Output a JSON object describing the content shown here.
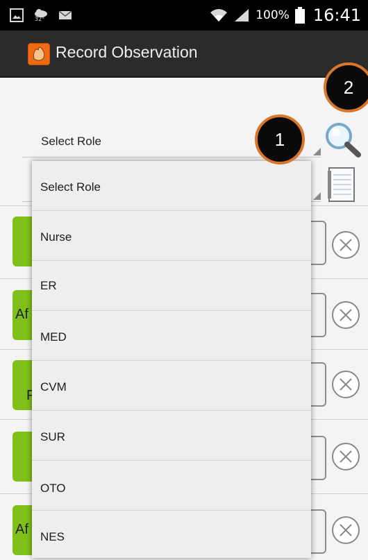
{
  "statusbar": {
    "left_icons": [
      "image-icon",
      "weather-icon",
      "mail-icon"
    ],
    "temp": "32°",
    "battery_pct": "100%",
    "time": "16:41"
  },
  "actionbar": {
    "title": "Record Observation"
  },
  "form": {
    "role_spinner_label": "Select Role",
    "second_spinner_label": ""
  },
  "list_rows": [
    {
      "tag_text": ""
    },
    {
      "tag_text": "Af"
    },
    {
      "tag_text": "F"
    },
    {
      "tag_text": ""
    },
    {
      "tag_text": "Af"
    }
  ],
  "dropdown": {
    "items": [
      "Select Role",
      "Nurse",
      "ER",
      "MED",
      "CVM",
      "SUR",
      "OTO",
      "NES"
    ]
  },
  "callouts": {
    "one": "1",
    "two": "2"
  },
  "colors": {
    "statusbar_bg": "#000000",
    "actionbar_bg": "#2b2b2b",
    "accent_green": "#7fc01a",
    "app_icon_orange": "#f06a13",
    "callout_border": "#d9762b"
  }
}
